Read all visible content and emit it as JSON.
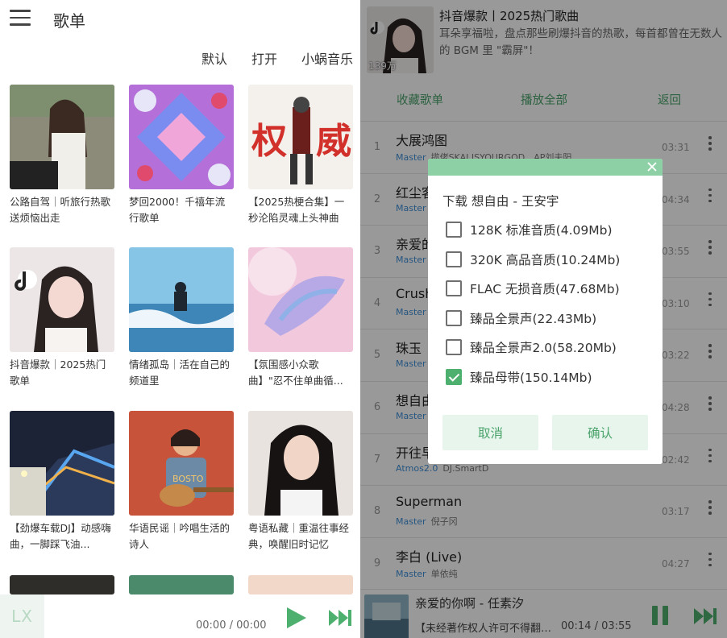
{
  "left": {
    "title": "歌单",
    "tabs": [
      "默认",
      "打开",
      "小蜗音乐"
    ],
    "cards": [
      {
        "title": "公路自驾｜听旅行热歌送烦恼出走"
      },
      {
        "title": "梦回2000！千禧年流行歌单"
      },
      {
        "title": "【2025热梗合集】一秒沦陷灵魂上头神曲"
      },
      {
        "title": "抖音爆款｜2025热门歌单"
      },
      {
        "title": "情绪孤岛｜活在自己的频道里"
      },
      {
        "title": "【氛围感小众歌曲】\"忍不住单曲循..."
      },
      {
        "title": "【劲爆车载DJ】动感嗨曲，一脚踩飞油..."
      },
      {
        "title": "华语民谣｜吟唱生活的诗人"
      },
      {
        "title": "粤语私藏｜重温往事经典，唤醒旧时记忆"
      }
    ],
    "player": {
      "logo": "LX",
      "time": "00:00 / 00:00"
    }
  },
  "right": {
    "playlist": {
      "title": "抖音爆款丨2025热门歌曲",
      "description": "耳朵享福啦，盘点那些刷爆抖音的热歌，每首都曾在无数人的 BGM 里 \"霸屏\"！",
      "play_count": "139万"
    },
    "actions": {
      "collect": "收藏歌单",
      "play_all": "播放全部",
      "back": "返回"
    },
    "songs": [
      {
        "idx": "1",
        "name": "大展鸿图",
        "quality": "Master",
        "artist": "揽佬SKAI ISYOURGOD、AP刘夫阳",
        "duration": "03:31"
      },
      {
        "idx": "2",
        "name": "红尘客",
        "quality": "Master",
        "artist": "",
        "duration": "04:34"
      },
      {
        "idx": "3",
        "name": "亲爱的",
        "quality": "Master",
        "artist": "",
        "duration": "03:55"
      },
      {
        "idx": "4",
        "name": "Crush",
        "quality": "Master",
        "artist": "",
        "duration": "03:10"
      },
      {
        "idx": "5",
        "name": "珠玉",
        "quality": "Master",
        "artist": "",
        "duration": "03:22"
      },
      {
        "idx": "6",
        "name": "想自由",
        "quality": "Master",
        "artist": "",
        "duration": "04:28"
      },
      {
        "idx": "7",
        "name": "开往早",
        "quality": "Atmos2.0",
        "artist": "DJ.SmartD",
        "duration": "02:42"
      },
      {
        "idx": "8",
        "name": "Superman",
        "quality": "Master",
        "artist": "倪子冈",
        "duration": "03:17"
      },
      {
        "idx": "9",
        "name": "李白 (Live)",
        "quality": "Master",
        "artist": "单依纯",
        "duration": "04:27"
      }
    ],
    "now_playing": {
      "title": "亲爱的你啊 - 任素汐",
      "lyric": "【未经著作权人许可不得翻唱、翻录或使用】",
      "time": "00:14 / 03:55"
    },
    "dialog": {
      "title": "下载 想自由 - 王安宇",
      "options": [
        {
          "label": "128K 标准音质(4.09Mb)",
          "checked": false
        },
        {
          "label": "320K 高品音质(10.24Mb)",
          "checked": false
        },
        {
          "label": "FLAC 无损音质(47.68Mb)",
          "checked": false
        },
        {
          "label": "臻品全景声(22.43Mb)",
          "checked": false
        },
        {
          "label": "臻品全景声2.0(58.20Mb)",
          "checked": false
        },
        {
          "label": "臻品母带(150.14Mb)",
          "checked": true
        }
      ],
      "cancel": "取消",
      "confirm": "确认"
    }
  },
  "colors": {
    "accent": "#4aa36b",
    "quality": "#3f8fd8",
    "dialog_bar": "#8ed0a6"
  }
}
